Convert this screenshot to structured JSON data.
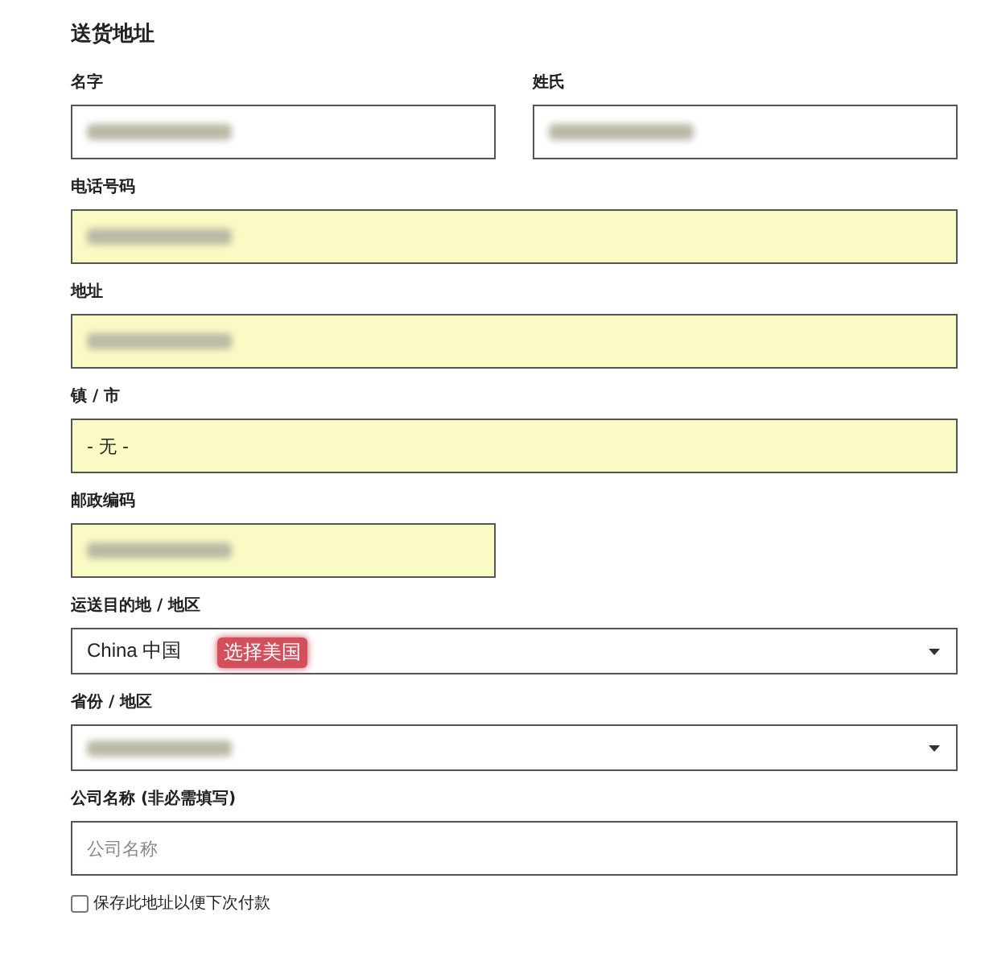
{
  "title": "送货地址",
  "rows": [
    {
      "fields": [
        {
          "label": "名字",
          "kind": "text",
          "wide": false,
          "autofilled": false,
          "redacted": true
        },
        {
          "label": "姓氏",
          "kind": "text",
          "wide": false,
          "autofilled": false,
          "redacted": true
        }
      ]
    },
    {
      "fields": [
        {
          "label": "电话号码",
          "kind": "text",
          "wide": true,
          "autofilled": true,
          "redacted": true
        }
      ]
    },
    {
      "fields": [
        {
          "label": "地址",
          "kind": "text",
          "wide": true,
          "autofilled": true,
          "redacted": true
        }
      ]
    },
    {
      "fields": [
        {
          "label": "镇 / 市",
          "kind": "text",
          "wide": true,
          "autofilled": true,
          "redacted": false,
          "value": "- 无 -"
        }
      ]
    },
    {
      "fields": [
        {
          "label": "邮政编码",
          "kind": "text",
          "wide": false,
          "autofilled": true,
          "redacted": true
        }
      ]
    },
    {
      "fields": [
        {
          "label": "运送目的地 / 地区",
          "kind": "select",
          "wide": true,
          "autofilled": false,
          "redacted": false,
          "value": "China 中国",
          "annotation": "选择美国"
        }
      ]
    },
    {
      "fields": [
        {
          "label": "省份 / 地区",
          "kind": "select",
          "wide": true,
          "autofilled": false,
          "redacted": true
        }
      ]
    },
    {
      "fields": [
        {
          "label": "公司名称 (非必需填写)",
          "kind": "text",
          "wide": true,
          "autofilled": false,
          "redacted": false,
          "placeholder": "公司名称"
        }
      ]
    }
  ],
  "save_address": {
    "label": "保存此地址以便下次付款",
    "checked": false
  }
}
